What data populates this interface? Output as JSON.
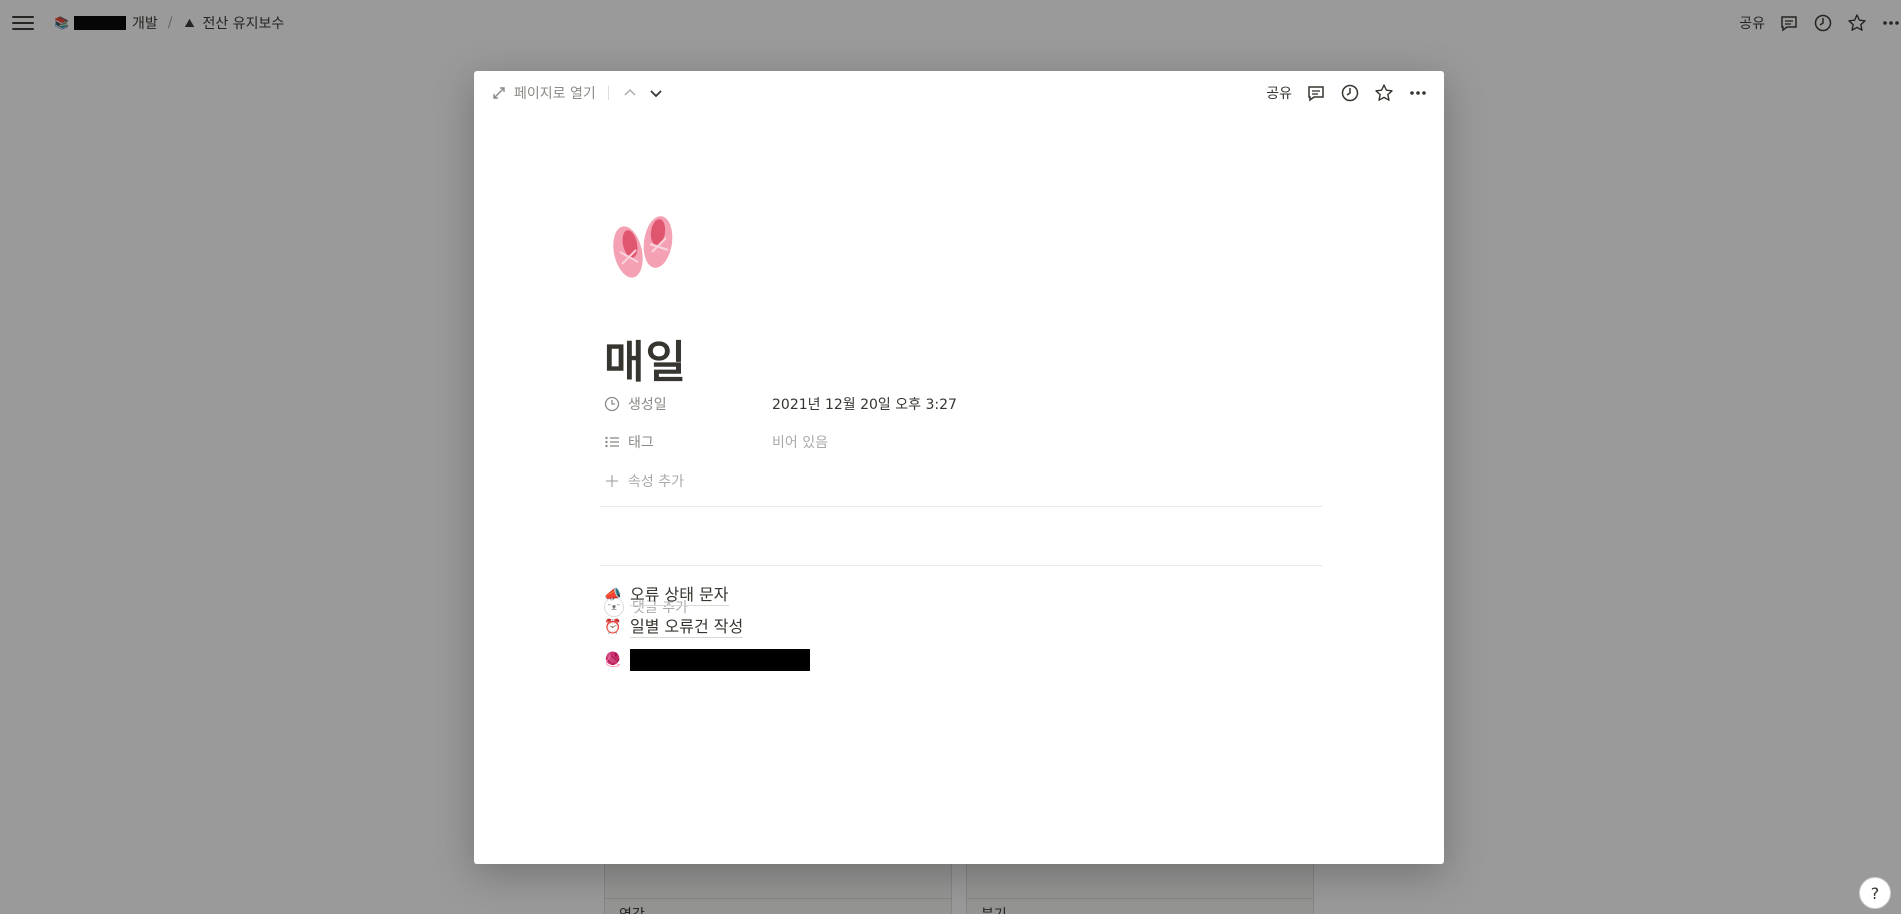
{
  "topbar": {
    "breadcrumb_1": "개발",
    "breadcrumb_2": "전산 유지보수",
    "share_label": "공유"
  },
  "board": {
    "column_1": "연간",
    "column_2": "분기"
  },
  "modal": {
    "open_as_page": "페이지로 열기",
    "share_label": "공유",
    "title": "매일",
    "properties": {
      "created_label": "생성일",
      "created_value": "2021년 12월 20일 오후 3:27",
      "tag_label": "태그",
      "tag_value": "비어 있음",
      "add_property": "속성 추가"
    },
    "comment_placeholder": "댓글 추가",
    "links": [
      {
        "icon": "megaphone-icon",
        "label": "오류 상태 문자"
      },
      {
        "icon": "alarm-clock-icon",
        "label": "일별 오류건 작성"
      },
      {
        "icon": "yarn-icon",
        "label": ""
      }
    ]
  },
  "help_label": "?",
  "colors": {
    "text": "#37352f",
    "muted": "#8b8a86",
    "placeholder": "#aaaaaa",
    "overlay": "rgba(15,15,15,0.42)"
  }
}
